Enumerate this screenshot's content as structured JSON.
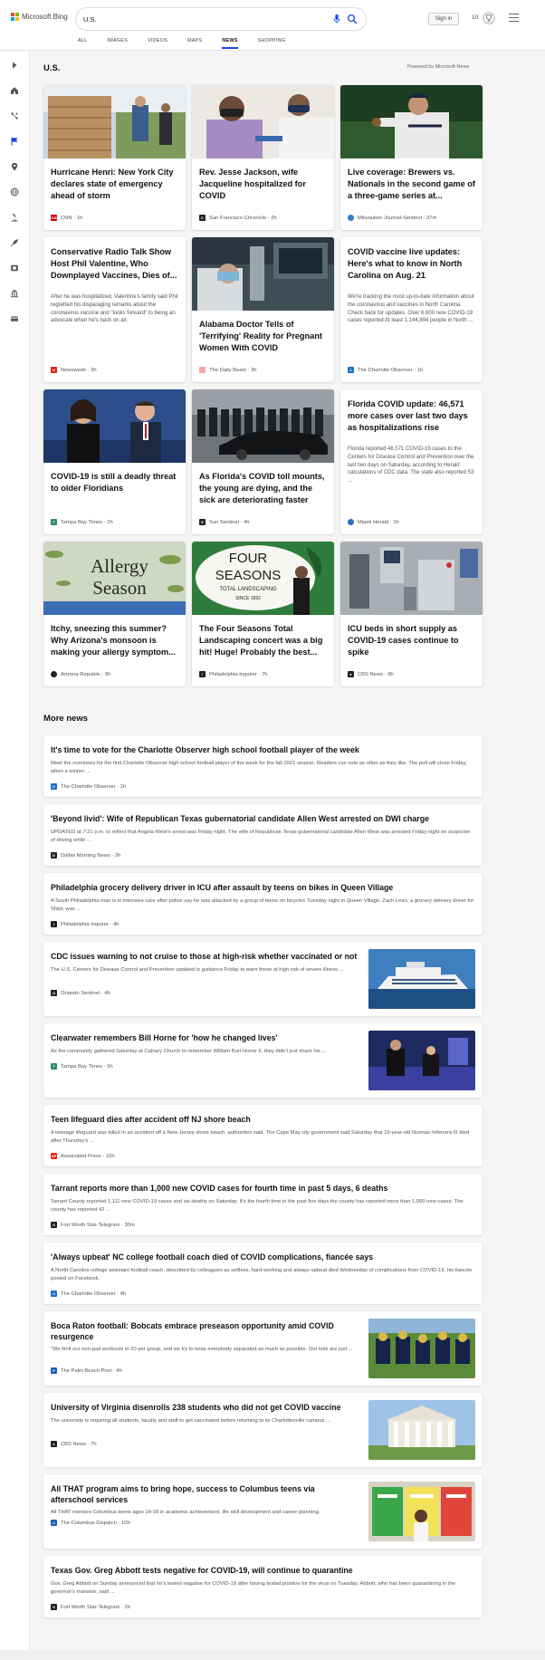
{
  "header": {
    "brand": "Microsoft Bing",
    "search_value": "U.S.",
    "signin_label": "Sign in",
    "rewards_count": "10"
  },
  "tabs": [
    {
      "label": "ALL",
      "active": false
    },
    {
      "label": "IMAGES",
      "active": false
    },
    {
      "label": "VIDEOS",
      "active": false
    },
    {
      "label": "MAPS",
      "active": false
    },
    {
      "label": "NEWS",
      "active": true
    },
    {
      "label": "SHOPPING",
      "active": false
    }
  ],
  "rail": [
    "expand-icon",
    "home-icon",
    "network-icon",
    "flag-icon",
    "location-pin-icon",
    "globe-icon",
    "microscope-icon",
    "rocket-icon",
    "film-icon",
    "bank-icon",
    "card-icon"
  ],
  "section": {
    "title": "U.S.",
    "powered_by": "Powered by Microsoft News"
  },
  "cards": [
    {
      "title": "Hurricane Henri: New York City declares state of emergency ahead of storm",
      "snippet": "",
      "source": "CNN",
      "time": "1h",
      "logo_color": "#cc0000"
    },
    {
      "title": "Rev. Jesse Jackson, wife Jacqueline hospitalized for COVID",
      "snippet": "",
      "source": "San Francisco Chronicle",
      "time": "2h",
      "logo_color": "#222222"
    },
    {
      "title": "Live coverage: Brewers vs. Nationals in the second game of a three-game series at...",
      "snippet": "",
      "source": "Milwaukee Journal-Sentinel",
      "time": "37m",
      "logo_color": "#2a7fd4"
    },
    {
      "title": "Conservative Radio Talk Show Host Phil Valentine, Who Downplayed Vaccines, Dies of...",
      "snippet": "After he was hospitalized, Valentine's family said Phil regretted his disparaging remarks about the coronavirus vaccine and \"looks forward\" to being an advocate when he's back on air.",
      "source": "Newsweek",
      "time": "3h",
      "logo_color": "#e1261c"
    },
    {
      "title": "Alabama Doctor Tells of 'Terrifying' Reality for Pregnant Women With COVID",
      "snippet": "",
      "source": "The Daily Beast",
      "time": "3h",
      "logo_color": "#f4a6a6"
    },
    {
      "title": "COVID vaccine live updates: Here's what to know in North Carolina on Aug. 21",
      "snippet": "We're tracking the most up-to-date information about the coronavirus and vaccines in North Carolina. Check back for updates. Over 6,600 new COVID-19 cases reported At least 1,144,894 people in North ...",
      "source": "The Charlotte Observer",
      "time": "1h",
      "logo_color": "#1a73c9"
    },
    {
      "title": "COVID-19 is still a deadly threat to older Floridians",
      "snippet": "",
      "source": "Tampa Bay Times",
      "time": "2h",
      "logo_color": "#2c8c6c"
    },
    {
      "title": "As Florida's COVID toll mounts, the young are dying, and the sick are deteriorating faster",
      "snippet": "",
      "source": "Sun Sentinel",
      "time": "4h",
      "logo_color": "#222222"
    },
    {
      "title": "Florida COVID update: 46,571 more cases over last two days as hospitalizations rise",
      "snippet": "Florida reported 46,571 COVID-19 cases to the Centers for Disease Control and Prevention over the last two days on Saturday, according to Herald calculations of CDC data. The state also reported 53 ...",
      "source": "Miami Herald",
      "time": "1h",
      "logo_color": "#2a6fc9"
    },
    {
      "title": "Itchy, sneezing this summer? Why Arizona's monsoon is making your allergy symptom...",
      "snippet": "",
      "source": "Arizona Republic",
      "time": "8h",
      "logo_color": "#222222"
    },
    {
      "title": "The Four Seasons Total Landscaping concert was a big hit! Huge! Probably the best...",
      "snippet": "",
      "source": "Philadelphia Inquirer",
      "time": "7h",
      "logo_color": "#222222"
    },
    {
      "title": "ICU beds in short supply as COVID-19 cases continue to spike",
      "snippet": "",
      "source": "CBS News",
      "time": "9h",
      "logo_color": "#222222"
    }
  ],
  "card_images": {
    "allergy_line1": "Allergy",
    "allergy_line2": "Season",
    "four": "FOUR",
    "seasons": "SEASONS",
    "total": "TOTAL LANDSCAPING",
    "since": "SINCE 1992"
  },
  "more_news": {
    "title": "More news",
    "items": [
      {
        "title": "It's time to vote for the Charlotte Observer high school football player of the week",
        "snippet": "Meet the nominees for the first Charlotte Observer high school football player of the week for the fall 2021 season. Readers can vote as often as they like. The poll will close Friday, when a winner ...",
        "source": "The Charlotte Observer",
        "time": "1h",
        "logo_color": "#1a73c9"
      },
      {
        "title": "'Beyond livid': Wife of Republican Texas gubernatorial candidate Allen West arrested on DWI charge",
        "snippet": "UPDATED at 7:21 p.m. to reflect that Angela West's arrest was Friday night. The wife of Republican Texas gubernatorial candidate Allen West was arrested Friday night on suspicion of driving while ...",
        "source": "Dallas Morning News",
        "time": "2h",
        "logo_color": "#222222"
      },
      {
        "title": "Philadelphia grocery delivery driver in ICU after assault by teens on bikes in Queen Village",
        "snippet": "A South Philadelphia man is in intensive care after police say he was attacked by a group of teens on bicycles Tuesday night in Queen Village. Zach Lean, a grocery delivery driver for Shipt, was ...",
        "source": "Philadelphia Inquirer",
        "time": "4h",
        "logo_color": "#222222"
      },
      {
        "title": "CDC issues warning to not cruise to those at high-risk whether vaccinated or not",
        "snippet": "The U.S. Centers for Disease Control and Prevention updated is guidance Friday to warn those at high risk of severe illness ...",
        "source": "Orlando Sentinel",
        "time": "4h",
        "logo_color": "#222222"
      },
      {
        "title": "Clearwater remembers Bill Horne for 'how he changed lives'",
        "snippet": "As the community gathered Saturday at Calvary Church to remember William Burt Horne II, they didn't just share his ...",
        "source": "Tampa Bay Times",
        "time": "5h",
        "logo_color": "#2c8c6c"
      },
      {
        "title": "Teen lifeguard dies after accident off NJ shore beach",
        "snippet": "A teenage lifeguard was killed in an accident off a New Jersey shore beach, authorities said. The Cape May city government said Saturday that 16-year-old Norman Inferrera III died after Thursday's ...",
        "source": "Associated Press",
        "time": "10h",
        "logo_color": "#e1261c"
      },
      {
        "title": "Tarrant reports more than 1,000 new COVID cases for fourth time in past 5 days, 6 deaths",
        "snippet": "Tarrant County reported 1,111 new COVID-19 cases and six deaths on Saturday. It's the fourth time in the past five days the county has reported more than 1,000 new cases. The county has reported 42 ...",
        "source": "Fort Worth Star-Telegram",
        "time": "30m",
        "logo_color": "#222222"
      },
      {
        "title": "'Always upbeat' NC college football coach died of COVID complications, fiancée says",
        "snippet": "A North Carolina college assistant football coach, described by colleagues as selfless, hard-working and always upbeat died Wednesday of complications from COVID-19, his fiancée posted on Facebook.",
        "source": "The Charlotte Observer",
        "time": "4h",
        "logo_color": "#1a73c9"
      },
      {
        "title": "Boca Raton football: Bobcats embrace preseason opportunity amid COVID resurgence",
        "snippet": "\"We limit our non-pad workouts to 20 per group, and we try to keep everybody separated as much as possible. Our kids are just ...",
        "source": "The Palm Beach Post",
        "time": "4h",
        "logo_color": "#1a5fb4"
      },
      {
        "title": "University of Virginia disenrolls 238 students who did not get COVID vaccine",
        "snippet": "The university is requiring all students, faculty and staff to get vaccinated before returning to its Charlottesville campus ...",
        "source": "CBS News",
        "time": "7h",
        "logo_color": "#222222"
      },
      {
        "title": "All THAT program aims to bring hope, success to Columbus teens via afterschool services",
        "snippet": "All THAT mentors Columbus teens ages 14-18 in academic achievement, life skill development and career planning.",
        "source": "The Columbus Dispatch",
        "time": "10h",
        "logo_color": "#1a5fb4"
      },
      {
        "title": "Texas Gov. Greg Abbott tests negative for COVID-19, will continue to quarantine",
        "snippet": "Gov. Greg Abbott on Sunday announced that he's tested negative for COVID-19 after having tested positive for the virus on Tuesday. Abbott, who has been quarantining in the governor's mansion, said ...",
        "source": "Fort Worth Star-Telegram",
        "time": "2h",
        "logo_color": "#222222"
      }
    ]
  },
  "colors": {
    "accent": "#174ae4",
    "background": "#f5f5f5"
  }
}
